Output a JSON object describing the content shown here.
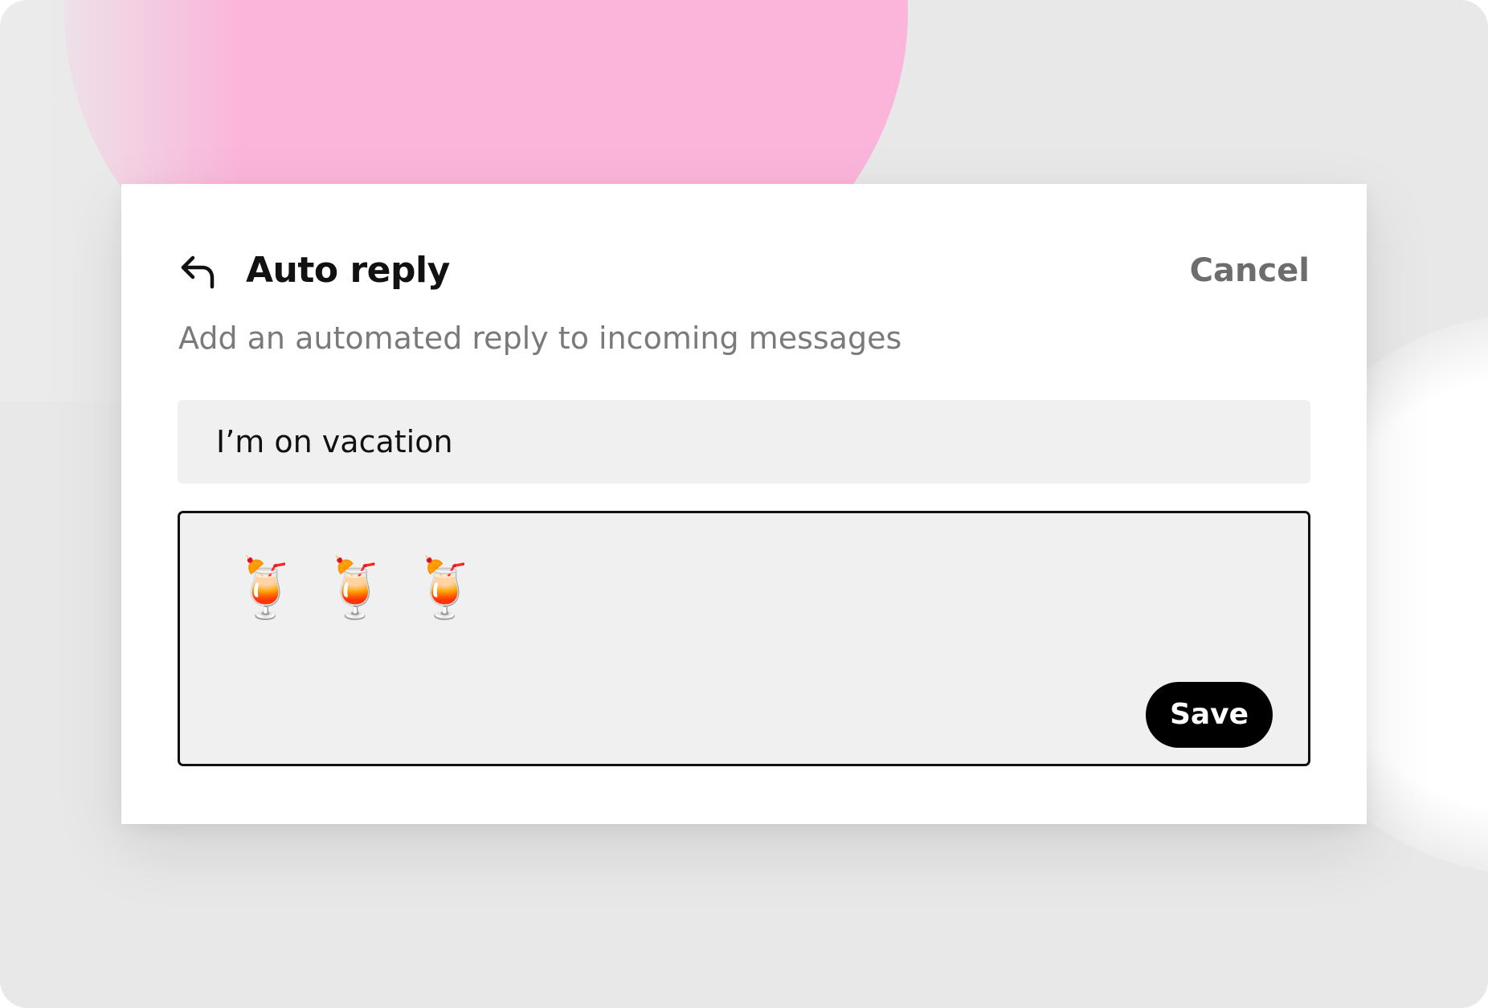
{
  "dialog": {
    "title": "Auto reply",
    "cancel_label": "Cancel",
    "description": "Add an automated reply to incoming messages"
  },
  "form": {
    "subject_value": "I’m on vacation",
    "message_value": "🍹🍹🍹",
    "save_label": "Save"
  },
  "icons": {
    "back": "reply-arrow-icon"
  },
  "colors": {
    "accent_pink": "#fbb5da",
    "button_bg": "#000000",
    "field_bg": "#f0f0f0",
    "muted_text": "#7a7a7a"
  }
}
